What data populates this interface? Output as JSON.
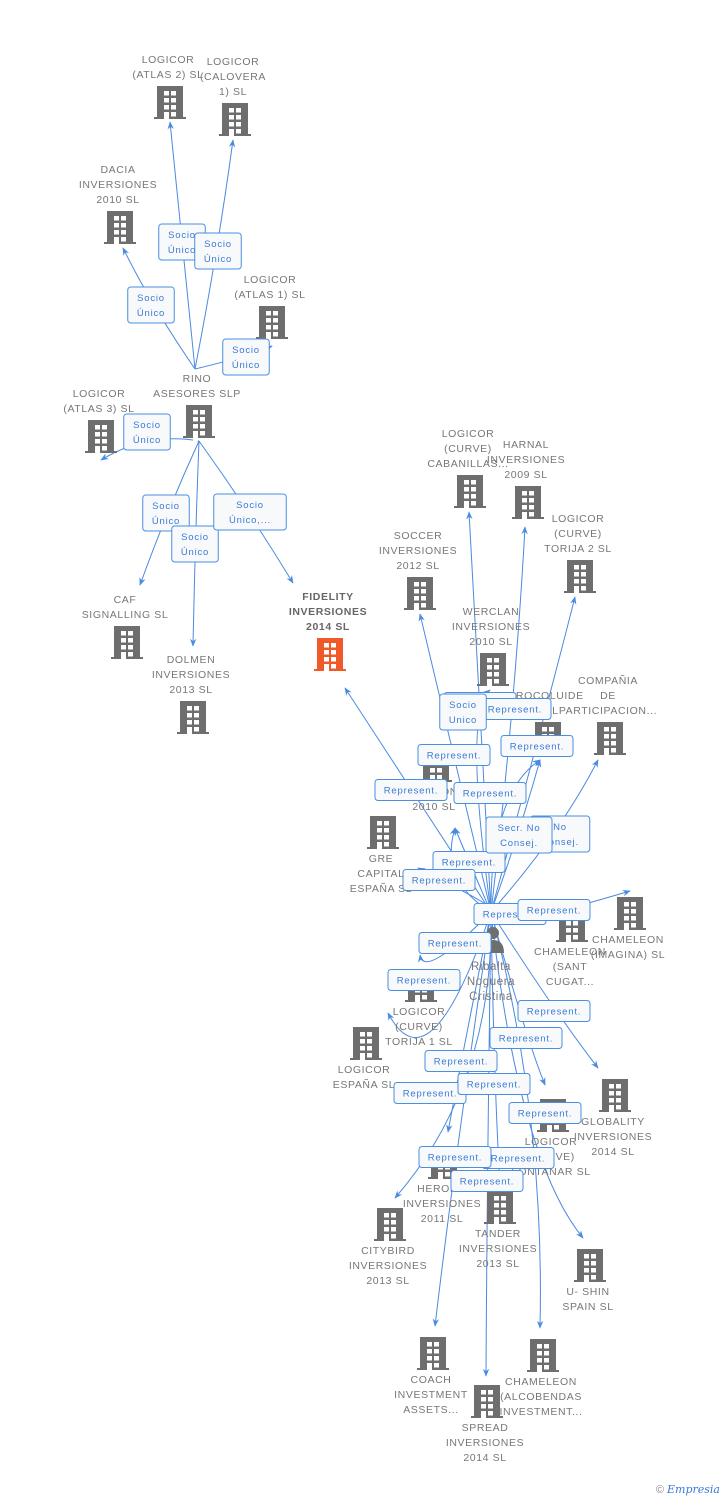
{
  "colors": {
    "edge": "#4a8ae0",
    "label_text": "#3a7bd5",
    "node_icon": "#6e6e6e",
    "highlight": "#f05a28"
  },
  "icons": {
    "company": "building-icon",
    "person": "person-icon"
  },
  "nodes": [
    {
      "id": "atlas2",
      "lines": [
        "LOGICOR",
        "(ATLAS 2)  SL"
      ]
    },
    {
      "id": "calovera",
      "lines": [
        "LOGICOR",
        "(CALOVERA",
        "1)  SL"
      ]
    },
    {
      "id": "dacia",
      "lines": [
        "DACIA",
        "INVERSIONES",
        "2010  SL"
      ]
    },
    {
      "id": "atlas1",
      "lines": [
        "LOGICOR",
        "(ATLAS 1)  SL"
      ]
    },
    {
      "id": "rino",
      "lines": [
        "RINO",
        "ASESORES SLP"
      ]
    },
    {
      "id": "atlas3",
      "lines": [
        "LOGICOR",
        "(ATLAS 3)  SL"
      ]
    },
    {
      "id": "caf",
      "lines": [
        "CAF",
        "SIGNALLING  SL"
      ]
    },
    {
      "id": "dolmen",
      "lines": [
        "DOLMEN",
        "INVERSIONES",
        "2013 SL"
      ]
    },
    {
      "id": "fidelity",
      "lines": [
        "FIDELITY",
        "INVERSIONES",
        "2014  SL"
      ],
      "highlight": true
    },
    {
      "id": "cabanillas",
      "lines": [
        "LOGICOR",
        "(CURVE)",
        "CABANILLAS..."
      ]
    },
    {
      "id": "harnal",
      "lines": [
        "HARNAL",
        "INVERSIONES",
        "2009 SL"
      ]
    },
    {
      "id": "torija2",
      "lines": [
        "LOGICOR",
        "(CURVE)",
        "TORIJA 2  SL"
      ]
    },
    {
      "id": "soccer",
      "lines": [
        "SOCCER",
        "INVERSIONES",
        "2012 SL"
      ]
    },
    {
      "id": "werclan",
      "lines": [
        "WERCLAN",
        "INVERSIONES",
        "2010 SL"
      ]
    },
    {
      "id": "procoluide",
      "lines": [
        "PROCOLUIDE",
        "S SL"
      ]
    },
    {
      "id": "compania",
      "lines": [
        "COMPAÑIA",
        "DE",
        "PARTICIPACION..."
      ]
    },
    {
      "id": "inv2010",
      "lines": [
        "INVERSIONES",
        "2010 SL"
      ]
    },
    {
      "id": "gre",
      "lines": [
        "GRE",
        "CAPITAL",
        "ESPAÑA  SL"
      ]
    },
    {
      "id": "santcugat",
      "lines": [
        "CHAMELEON",
        "(SANT",
        "CUGAT..."
      ]
    },
    {
      "id": "imagina",
      "lines": [
        "CHAMELEON",
        "(IMAGINA)  SL"
      ]
    },
    {
      "id": "torija1",
      "lines": [
        "LOGICOR",
        "(CURVE)",
        "TORIJA 1  SL"
      ]
    },
    {
      "id": "espana",
      "lines": [
        "LOGICOR",
        "ESPAÑA  SL"
      ]
    },
    {
      "id": "globality",
      "lines": [
        "GLOBALITY",
        "INVERSIONES",
        "2014  SL"
      ]
    },
    {
      "id": "fontanar",
      "lines": [
        "LOGICOR",
        "(CURVE)",
        "FONTANAR  SL"
      ]
    },
    {
      "id": "herome",
      "lines": [
        "HEROME",
        "INVERSIONES",
        "2011 SL"
      ]
    },
    {
      "id": "tander",
      "lines": [
        "TANDER",
        "INVERSIONES",
        "2013 SL"
      ]
    },
    {
      "id": "citybird",
      "lines": [
        "CITYBIRD",
        "INVERSIONES",
        "2013  SL"
      ]
    },
    {
      "id": "ushin",
      "lines": [
        "U- SHIN",
        "SPAIN  SL"
      ]
    },
    {
      "id": "coach",
      "lines": [
        "COACH",
        "INVESTMENT",
        "ASSETS..."
      ]
    },
    {
      "id": "alcobendas",
      "lines": [
        "CHAMELEON",
        "(ALCOBENDAS",
        "INVESTMENT..."
      ]
    },
    {
      "id": "spread",
      "lines": [
        "SPREAD",
        "INVERSIONES",
        "2014  SL"
      ]
    },
    {
      "id": "person",
      "lines": [
        "Ribalta",
        "Noguera",
        "Cristina"
      ],
      "person": true
    }
  ],
  "edges": [
    {
      "from": "rino",
      "to": "atlas2",
      "label": [
        "Socio",
        "Único"
      ]
    },
    {
      "from": "rino",
      "to": "calovera",
      "label": [
        "Socio",
        "Único"
      ]
    },
    {
      "from": "rino",
      "to": "dacia",
      "label": [
        "Socio",
        "Único"
      ]
    },
    {
      "from": "rino",
      "to": "atlas1",
      "label": [
        "Socio",
        "Único"
      ]
    },
    {
      "from": "rino",
      "to": "atlas3",
      "label": [
        "Socio",
        "Único"
      ]
    },
    {
      "from": "rino",
      "to": "caf",
      "label": [
        "Socio",
        "Único"
      ]
    },
    {
      "from": "rino",
      "to": "dolmen",
      "label": [
        "Socio",
        "Único"
      ]
    },
    {
      "from": "rino",
      "to": "fidelity",
      "label": [
        "Socio",
        "Único,..."
      ]
    },
    {
      "from": "person",
      "to": "fidelity",
      "label": [
        "Represent."
      ]
    },
    {
      "from": "person",
      "to": "cabanillas",
      "label": [
        "Represent."
      ]
    },
    {
      "from": "person",
      "to": "harnal",
      "label": [
        "Represent."
      ]
    },
    {
      "from": "person",
      "to": "werclan",
      "label": [
        "Socio",
        "Unico"
      ]
    },
    {
      "from": "person",
      "to": "soccer",
      "label": [
        "Represent."
      ]
    },
    {
      "from": "person",
      "to": "torija2",
      "label": [
        "Represent."
      ]
    },
    {
      "from": "person",
      "to": "procoluide",
      "label": [
        "Represent."
      ]
    },
    {
      "from": "person",
      "to": "compania",
      "label": [
        "No",
        "Consej."
      ]
    },
    {
      "from": "person",
      "to": "inv2010",
      "label": [
        "Represent."
      ]
    },
    {
      "from": "person",
      "to": "procoluide",
      "label": [
        "Secr. No",
        "Consej."
      ]
    },
    {
      "from": "person",
      "to": "inv2010",
      "label": [
        "Represent."
      ]
    },
    {
      "from": "person",
      "to": "gre",
      "label": [
        "Represent."
      ]
    },
    {
      "from": "person",
      "to": "santcugat",
      "label": [
        "Represent."
      ]
    },
    {
      "from": "person",
      "to": "imagina",
      "label": [
        "Represent."
      ]
    },
    {
      "from": "person",
      "to": "torija1",
      "label": [
        "Represent."
      ]
    },
    {
      "from": "person",
      "to": "espana",
      "label": [
        "Represent."
      ]
    },
    {
      "from": "person",
      "to": "globality",
      "label": [
        "Represent."
      ]
    },
    {
      "from": "person",
      "to": "fontanar",
      "label": [
        "Represent."
      ]
    },
    {
      "from": "person",
      "to": "herome",
      "label": [
        "Represent."
      ]
    },
    {
      "from": "person",
      "to": "tander",
      "label": [
        "Represent."
      ]
    },
    {
      "from": "person",
      "to": "citybird",
      "label": [
        "Represent."
      ]
    },
    {
      "from": "person",
      "to": "ushin",
      "label": [
        "Represent."
      ]
    },
    {
      "from": "person",
      "to": "coach",
      "label": [
        "Represent."
      ]
    },
    {
      "from": "person",
      "to": "alcobendas",
      "label": [
        "Represent."
      ]
    },
    {
      "from": "person",
      "to": "spread",
      "label": [
        "Represent."
      ]
    }
  ],
  "footer": {
    "copyright": "©",
    "brand": "Empresia"
  }
}
